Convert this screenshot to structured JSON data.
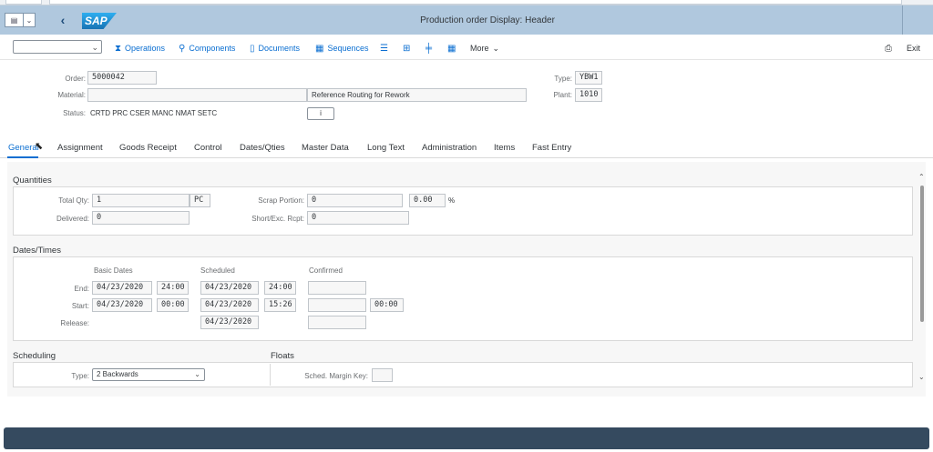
{
  "shell": {
    "title": "Production order Display: Header",
    "logo": "SAP",
    "menu_icon": "menu-icon",
    "back_icon": "back-chevron-icon"
  },
  "toolbar": {
    "dropdown_value": "",
    "buttons": {
      "operations": "Operations",
      "components": "Components",
      "documents": "Documents",
      "sequences": "Sequences",
      "more": "More",
      "exit": "Exit"
    }
  },
  "header": {
    "order_label": "Order:",
    "order_value": "5000042",
    "type_label": "Type:",
    "type_value": "YBW1",
    "material_label": "Material:",
    "material_value": "",
    "material_desc": "Reference Routing for Rework",
    "plant_label": "Plant:",
    "plant_value": "1010",
    "status_label": "Status:",
    "status_value": "CRTD PRC  CSER MANC NMAT SETC",
    "info_glyph": "i"
  },
  "tabs": [
    {
      "label": "General"
    },
    {
      "label": "Assignment"
    },
    {
      "label": "Goods Receipt"
    },
    {
      "label": "Control"
    },
    {
      "label": "Dates/Qties"
    },
    {
      "label": "Master Data"
    },
    {
      "label": "Long Text"
    },
    {
      "label": "Administration"
    },
    {
      "label": "Items"
    },
    {
      "label": "Fast Entry"
    }
  ],
  "quantities": {
    "title": "Quantities",
    "total_qty_label": "Total Qty:",
    "total_qty_value": "1",
    "unit_value": "PC",
    "scrap_portion_label": "Scrap Portion:",
    "scrap_portion_value": "0",
    "scrap_pct_value": "0.00",
    "pct_sign": "%",
    "delivered_label": "Delivered:",
    "delivered_value": "0",
    "short_exc_label": "Short/Exc. Rcpt:",
    "short_exc_value": "0"
  },
  "dates": {
    "title": "Dates/Times",
    "col_basic": "Basic Dates",
    "col_scheduled": "Scheduled",
    "col_confirmed": "Confirmed",
    "end_label": "End:",
    "start_label": "Start:",
    "release_label": "Release:",
    "end_basic_date": "04/23/2020",
    "end_basic_time": "24:00",
    "end_sched_date": "04/23/2020",
    "end_sched_time": "24:00",
    "end_conf": "",
    "start_basic_date": "04/23/2020",
    "start_basic_time": "00:00",
    "start_sched_date": "04/23/2020",
    "start_sched_time": "15:26",
    "start_conf": "",
    "start_conf_time": "00:00",
    "release_sched_date": "04/23/2020",
    "release_conf": ""
  },
  "scheduling": {
    "title": "Scheduling",
    "type_label": "Type:",
    "type_value": "2 Backwards"
  },
  "floats": {
    "title": "Floats",
    "margin_key_label": "Sched. Margin Key:",
    "margin_key_value": ""
  }
}
